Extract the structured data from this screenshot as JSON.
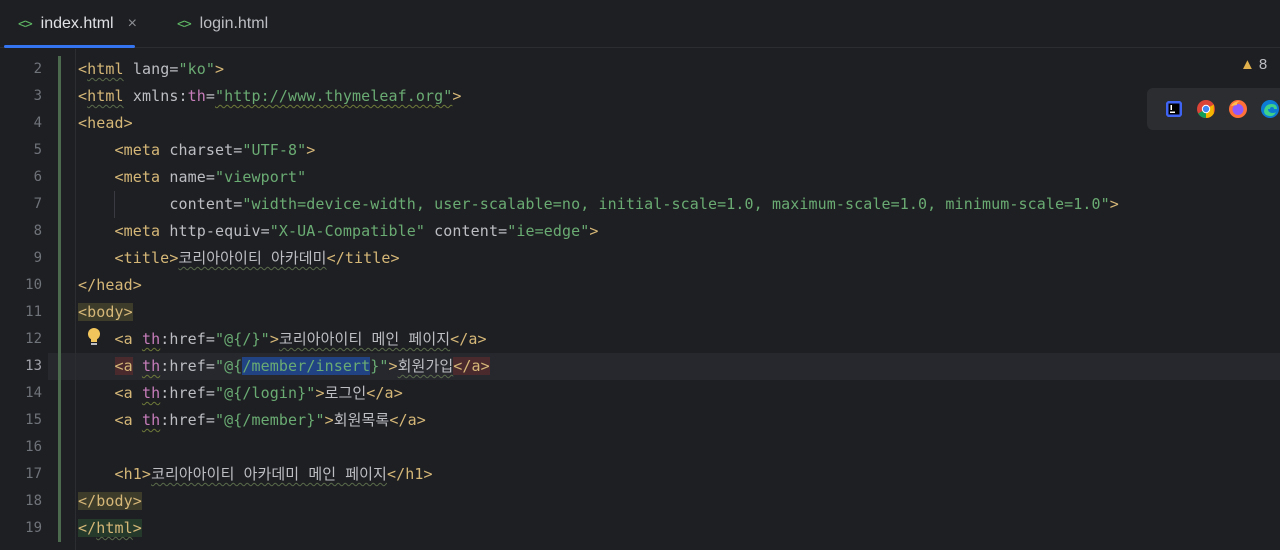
{
  "tabs": [
    {
      "label": "index.html",
      "active": true,
      "icon": "html-file-icon",
      "closable": true
    },
    {
      "label": "login.html",
      "active": false,
      "icon": "html-file-icon"
    }
  ],
  "icons": {
    "tab_file": "<>",
    "close": "×",
    "warning": "▲"
  },
  "warnings": {
    "count": "8"
  },
  "browsers": [
    "intellij-icon",
    "chrome-icon",
    "firefox-icon",
    "edge-icon"
  ],
  "editor": {
    "current_line": 13,
    "line_numbers": [
      "2",
      "3",
      "4",
      "5",
      "6",
      "7",
      "8",
      "9",
      "10",
      "11",
      "12",
      "13",
      "14",
      "15",
      "16",
      "17",
      "18",
      "19"
    ],
    "lines": {
      "l2": {
        "lang_attr": "lang",
        "lang_val": "\"ko\""
      },
      "l3": {
        "xmlns": "xmlns:",
        "th": "th",
        "url": "\"http://www.thymeleaf.org\""
      },
      "l5": {
        "charset_val": "\"UTF-8\""
      },
      "l6": {
        "name_val": "\"viewport\""
      },
      "l7": {
        "content_val": "\"width=device-width, user-scalable=no, initial-scale=1.0, maximum-scale=1.0, minimum-scale=1.0\""
      },
      "l8": {
        "equiv_val": "\"X-UA-Compatible\"",
        "content_val": "\"ie=edge\""
      },
      "l9": {
        "title": "코리아아이티 아카데미"
      },
      "l12": {
        "href_pre": "\"@{",
        "href_path": "/",
        "href_post": "}\"",
        "text": "코리아아이티 메인 페이지"
      },
      "l13": {
        "href_pre": "\"@{",
        "href_path": "/member/insert",
        "href_post": "}\"",
        "text": "회원가입"
      },
      "l14": {
        "href": "\"@{/login}\"",
        "text": "로그인"
      },
      "l15": {
        "href": "\"@{/member}\"",
        "text": "회원목록"
      },
      "l17": {
        "text": "코리아아이티 아카데미 메인 페이지"
      }
    }
  }
}
